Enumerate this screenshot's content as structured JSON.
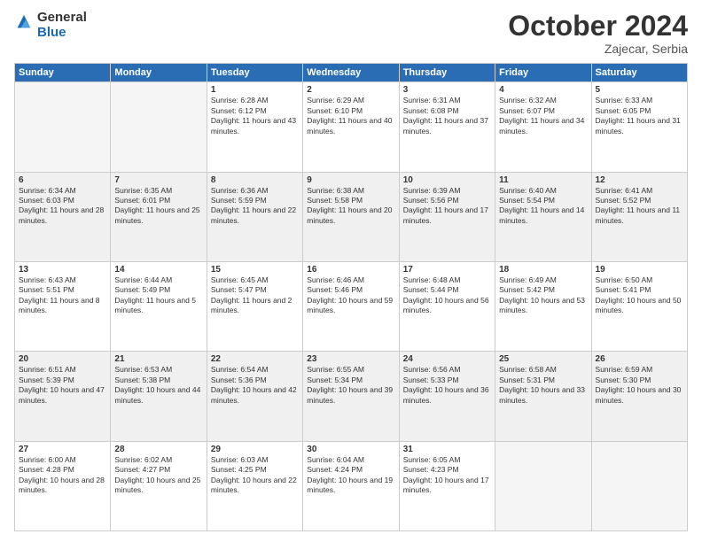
{
  "header": {
    "logo_general": "General",
    "logo_blue": "Blue",
    "month_title": "October 2024",
    "location": "Zajecar, Serbia"
  },
  "days_of_week": [
    "Sunday",
    "Monday",
    "Tuesday",
    "Wednesday",
    "Thursday",
    "Friday",
    "Saturday"
  ],
  "weeks": [
    [
      {
        "day": "",
        "empty": true
      },
      {
        "day": "",
        "empty": true
      },
      {
        "day": "1",
        "sunrise": "6:28 AM",
        "sunset": "6:12 PM",
        "daylight": "11 hours and 43 minutes."
      },
      {
        "day": "2",
        "sunrise": "6:29 AM",
        "sunset": "6:10 PM",
        "daylight": "11 hours and 40 minutes."
      },
      {
        "day": "3",
        "sunrise": "6:31 AM",
        "sunset": "6:08 PM",
        "daylight": "11 hours and 37 minutes."
      },
      {
        "day": "4",
        "sunrise": "6:32 AM",
        "sunset": "6:07 PM",
        "daylight": "11 hours and 34 minutes."
      },
      {
        "day": "5",
        "sunrise": "6:33 AM",
        "sunset": "6:05 PM",
        "daylight": "11 hours and 31 minutes."
      }
    ],
    [
      {
        "day": "6",
        "sunrise": "6:34 AM",
        "sunset": "6:03 PM",
        "daylight": "11 hours and 28 minutes."
      },
      {
        "day": "7",
        "sunrise": "6:35 AM",
        "sunset": "6:01 PM",
        "daylight": "11 hours and 25 minutes."
      },
      {
        "day": "8",
        "sunrise": "6:36 AM",
        "sunset": "5:59 PM",
        "daylight": "11 hours and 22 minutes."
      },
      {
        "day": "9",
        "sunrise": "6:38 AM",
        "sunset": "5:58 PM",
        "daylight": "11 hours and 20 minutes."
      },
      {
        "day": "10",
        "sunrise": "6:39 AM",
        "sunset": "5:56 PM",
        "daylight": "11 hours and 17 minutes."
      },
      {
        "day": "11",
        "sunrise": "6:40 AM",
        "sunset": "5:54 PM",
        "daylight": "11 hours and 14 minutes."
      },
      {
        "day": "12",
        "sunrise": "6:41 AM",
        "sunset": "5:52 PM",
        "daylight": "11 hours and 11 minutes."
      }
    ],
    [
      {
        "day": "13",
        "sunrise": "6:43 AM",
        "sunset": "5:51 PM",
        "daylight": "11 hours and 8 minutes."
      },
      {
        "day": "14",
        "sunrise": "6:44 AM",
        "sunset": "5:49 PM",
        "daylight": "11 hours and 5 minutes."
      },
      {
        "day": "15",
        "sunrise": "6:45 AM",
        "sunset": "5:47 PM",
        "daylight": "11 hours and 2 minutes."
      },
      {
        "day": "16",
        "sunrise": "6:46 AM",
        "sunset": "5:46 PM",
        "daylight": "10 hours and 59 minutes."
      },
      {
        "day": "17",
        "sunrise": "6:48 AM",
        "sunset": "5:44 PM",
        "daylight": "10 hours and 56 minutes."
      },
      {
        "day": "18",
        "sunrise": "6:49 AM",
        "sunset": "5:42 PM",
        "daylight": "10 hours and 53 minutes."
      },
      {
        "day": "19",
        "sunrise": "6:50 AM",
        "sunset": "5:41 PM",
        "daylight": "10 hours and 50 minutes."
      }
    ],
    [
      {
        "day": "20",
        "sunrise": "6:51 AM",
        "sunset": "5:39 PM",
        "daylight": "10 hours and 47 minutes."
      },
      {
        "day": "21",
        "sunrise": "6:53 AM",
        "sunset": "5:38 PM",
        "daylight": "10 hours and 44 minutes."
      },
      {
        "day": "22",
        "sunrise": "6:54 AM",
        "sunset": "5:36 PM",
        "daylight": "10 hours and 42 minutes."
      },
      {
        "day": "23",
        "sunrise": "6:55 AM",
        "sunset": "5:34 PM",
        "daylight": "10 hours and 39 minutes."
      },
      {
        "day": "24",
        "sunrise": "6:56 AM",
        "sunset": "5:33 PM",
        "daylight": "10 hours and 36 minutes."
      },
      {
        "day": "25",
        "sunrise": "6:58 AM",
        "sunset": "5:31 PM",
        "daylight": "10 hours and 33 minutes."
      },
      {
        "day": "26",
        "sunrise": "6:59 AM",
        "sunset": "5:30 PM",
        "daylight": "10 hours and 30 minutes."
      }
    ],
    [
      {
        "day": "27",
        "sunrise": "6:00 AM",
        "sunset": "4:28 PM",
        "daylight": "10 hours and 28 minutes."
      },
      {
        "day": "28",
        "sunrise": "6:02 AM",
        "sunset": "4:27 PM",
        "daylight": "10 hours and 25 minutes."
      },
      {
        "day": "29",
        "sunrise": "6:03 AM",
        "sunset": "4:25 PM",
        "daylight": "10 hours and 22 minutes."
      },
      {
        "day": "30",
        "sunrise": "6:04 AM",
        "sunset": "4:24 PM",
        "daylight": "10 hours and 19 minutes."
      },
      {
        "day": "31",
        "sunrise": "6:05 AM",
        "sunset": "4:23 PM",
        "daylight": "10 hours and 17 minutes."
      },
      {
        "day": "",
        "empty": true
      },
      {
        "day": "",
        "empty": true
      }
    ]
  ]
}
